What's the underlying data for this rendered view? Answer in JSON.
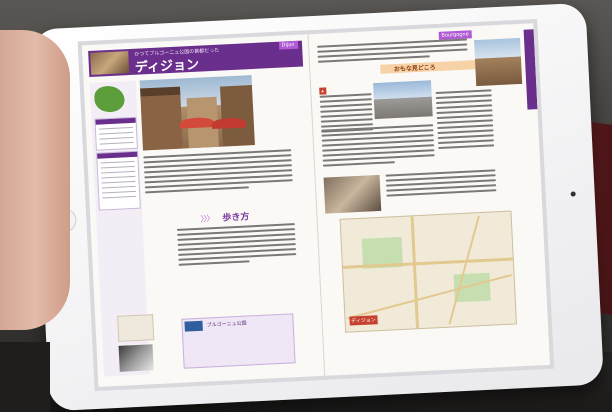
{
  "left_page": {
    "kicker": "かつてブルゴーニュ公国の首都だった",
    "title": "ディジョン",
    "region_tag": "Dijon",
    "section_walk": "歩き方",
    "feature_title": "ブルゴーニュ公国"
  },
  "right_page": {
    "region_tag": "Bourgogne",
    "recommend": "おもな見どころ",
    "side_tab": "ブルゴーニュ",
    "map_label": "ディジョン"
  }
}
